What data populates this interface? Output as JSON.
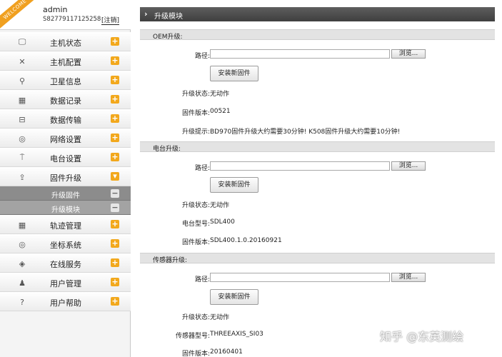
{
  "user": {
    "badge": "WELCOME",
    "name": "admin",
    "id": "S82779117125258",
    "logout": "[注销]"
  },
  "sidebar": {
    "items": [
      {
        "label": "主机状态",
        "icon": "monitor-icon",
        "glyph": "🖵"
      },
      {
        "label": "主机配置",
        "icon": "tools-icon",
        "glyph": "✕"
      },
      {
        "label": "卫星信息",
        "icon": "satellite-icon",
        "glyph": "⚲"
      },
      {
        "label": "数据记录",
        "icon": "calendar-icon",
        "glyph": "▦"
      },
      {
        "label": "数据传输",
        "icon": "network-icon",
        "glyph": "⊟"
      },
      {
        "label": "网络设置",
        "icon": "globe-icon",
        "glyph": "◎"
      },
      {
        "label": "电台设置",
        "icon": "antenna-icon",
        "glyph": "⍑"
      },
      {
        "label": "固件升级",
        "icon": "upload-icon",
        "glyph": "⇪"
      }
    ],
    "subitems": [
      {
        "label": "升级固件"
      },
      {
        "label": "升级模块"
      }
    ],
    "items_after": [
      {
        "label": "轨迹管理",
        "icon": "calendar-icon",
        "glyph": "▦"
      },
      {
        "label": "坐标系统",
        "icon": "globe-icon",
        "glyph": "◎"
      },
      {
        "label": "在线服务",
        "icon": "cube-icon",
        "glyph": "◈"
      },
      {
        "label": "用户管理",
        "icon": "user-icon",
        "glyph": "♟"
      },
      {
        "label": "用户帮助",
        "icon": "help-icon",
        "glyph": "?"
      }
    ]
  },
  "main": {
    "title": "升级模块",
    "oem": {
      "header": "OEM升级:",
      "path_label": "路径:",
      "path_value": "",
      "browse": "浏览...",
      "install": "安装新固件",
      "status_label": "升级状态:",
      "status_value": "无动作",
      "version_label": "固件版本:",
      "version_value": "00521",
      "hint_label": "升级提示:",
      "hint_value": "BD970固件升级大约需要30分钟! K508固件升级大约需要10分钟!"
    },
    "radio": {
      "header": "电台升级:",
      "path_label": "路径:",
      "path_value": "",
      "browse": "浏览...",
      "install": "安装新固件",
      "status_label": "升级状态:",
      "status_value": "无动作",
      "model_label": "电台型号:",
      "model_value": "SDL400",
      "version_label": "固件版本:",
      "version_value": "SDL400.1.0.20160921"
    },
    "sensor": {
      "header": "传感器升级:",
      "path_label": "路径:",
      "path_value": "",
      "browse": "浏览...",
      "install": "安装新固件",
      "status_label": "升级状态:",
      "status_value": "无动作",
      "model_label": "传感器型号:",
      "model_value": "THREEAXIS_SI03",
      "version_label": "固件版本:",
      "version_value": "20160401"
    }
  },
  "watermark": "知乎 @东英测绘"
}
